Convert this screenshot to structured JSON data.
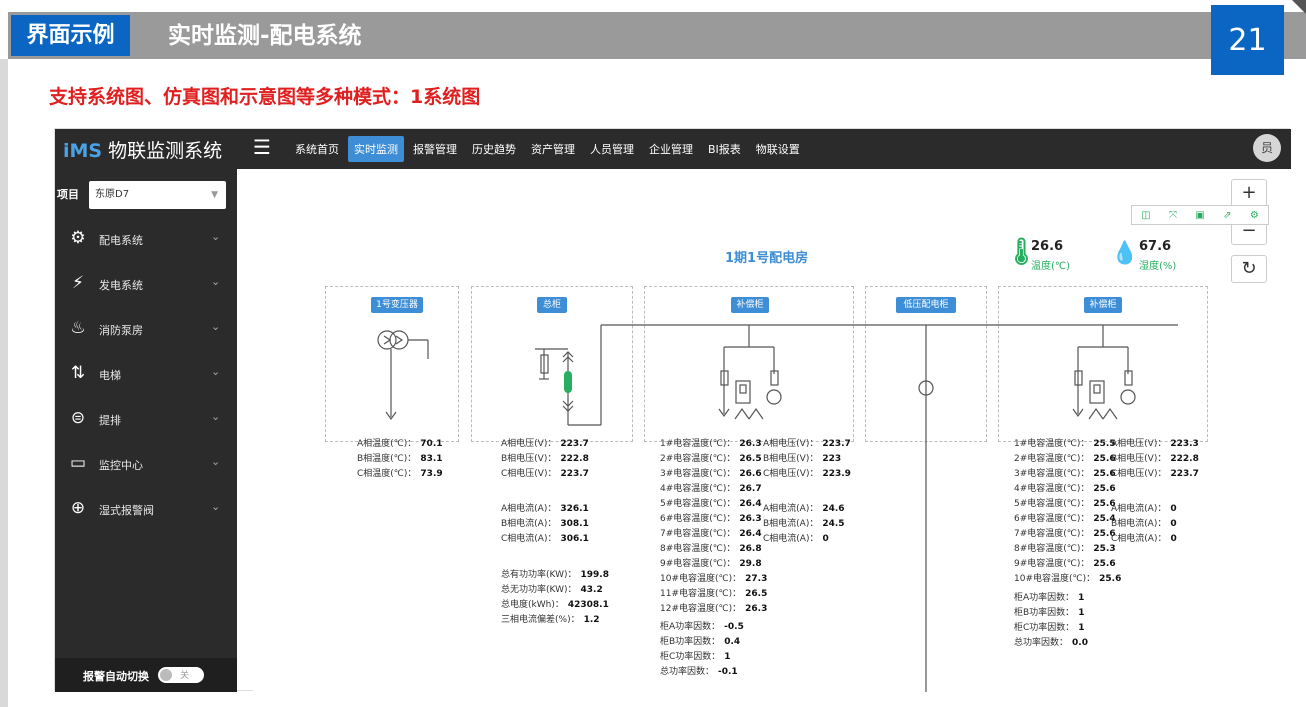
{
  "slide": {
    "badge": "界面示例",
    "title": "实时监测-配电系统",
    "page": "21",
    "subtitle": "支持系统图、仿真图和示意图等多种模式：1系统图"
  },
  "app": {
    "logo_brand": "iMS",
    "logo_text": "物联监测系统",
    "nav": [
      {
        "label": "系统首页"
      },
      {
        "label": "实时监测"
      },
      {
        "label": "报警管理"
      },
      {
        "label": "历史趋势"
      },
      {
        "label": "资产管理"
      },
      {
        "label": "人员管理"
      },
      {
        "label": "企业管理"
      },
      {
        "label": "BI报表"
      },
      {
        "label": "物联设置"
      }
    ],
    "avatar": "员"
  },
  "sidebar": {
    "project_label": "项目",
    "project_value": "东原D7",
    "items": [
      {
        "label": "配电系统",
        "icon": "robot-icon"
      },
      {
        "label": "发电系统",
        "icon": "generator-icon"
      },
      {
        "label": "消防泵房",
        "icon": "hydrant-icon"
      },
      {
        "label": "电梯",
        "icon": "elevator-icon"
      },
      {
        "label": "提排",
        "icon": "pump-icon"
      },
      {
        "label": "监控中心",
        "icon": "monitor-icon"
      },
      {
        "label": "湿式报警阀",
        "icon": "valve-icon"
      }
    ],
    "footer_label": "报警自动切换",
    "toggle_text": "关"
  },
  "diagram": {
    "title": "1期1号配电房",
    "temperature": {
      "value": "26.6",
      "label": "温度(℃)"
    },
    "humidity": {
      "value": "67.6",
      "label": "湿度(%)"
    },
    "tags": [
      "1号变压器",
      "总柜",
      "补偿柜",
      "低压配电柜",
      "补偿柜"
    ],
    "transformer": [
      [
        "A相温度(℃)：",
        "70.1"
      ],
      [
        "B相温度(℃)：",
        "83.1"
      ],
      [
        "C相温度(℃)：",
        "73.9"
      ]
    ],
    "main_v": [
      [
        "A相电压(V)：",
        "223.7"
      ],
      [
        "B相电压(V)：",
        "222.8"
      ],
      [
        "C相电压(V)：",
        "223.7"
      ]
    ],
    "main_i": [
      [
        "A相电流(A)：",
        "326.1"
      ],
      [
        "B相电流(A)：",
        "308.1"
      ],
      [
        "C相电流(A)：",
        "306.1"
      ]
    ],
    "main_p": [
      [
        "总有功功率(KW)：",
        "199.8"
      ],
      [
        "总无功功率(KW)：",
        "43.2"
      ],
      [
        "总电度(kWh)：",
        "42308.1"
      ],
      [
        "三相电流偏差(%)：",
        "1.2"
      ]
    ],
    "comp1_temp": [
      [
        "1#电容温度(℃)：",
        "26.3"
      ],
      [
        "2#电容温度(℃)：",
        "26.5"
      ],
      [
        "3#电容温度(℃)：",
        "26.6"
      ],
      [
        "4#电容温度(℃)：",
        "26.7"
      ],
      [
        "5#电容温度(℃)：",
        "26.4"
      ],
      [
        "6#电容温度(℃)：",
        "26.3"
      ],
      [
        "7#电容温度(℃)：",
        "26.4"
      ],
      [
        "8#电容温度(℃)：",
        "26.8"
      ],
      [
        "9#电容温度(℃)：",
        "29.8"
      ],
      [
        "10#电容温度(℃)：",
        "27.3"
      ],
      [
        "11#电容温度(℃)：",
        "26.5"
      ],
      [
        "12#电容温度(℃)：",
        "26.3"
      ]
    ],
    "comp1_v": [
      [
        "A相电压(V)：",
        "223.7"
      ],
      [
        "B相电压(V)：",
        "223"
      ],
      [
        "C相电压(V)：",
        "223.9"
      ]
    ],
    "comp1_i": [
      [
        "A相电流(A)：",
        "24.6"
      ],
      [
        "B相电流(A)：",
        "24.5"
      ],
      [
        "C相电流(A)：",
        "0"
      ]
    ],
    "comp1_pf": [
      [
        "柜A功率因数：",
        "-0.5"
      ],
      [
        "柜B功率因数：",
        "0.4"
      ],
      [
        "柜C功率因数：",
        "1"
      ],
      [
        "总功率因数：",
        "-0.1"
      ]
    ],
    "comp2_temp": [
      [
        "1#电容温度(℃)：",
        "25.5"
      ],
      [
        "2#电容温度(℃)：",
        "25.6"
      ],
      [
        "3#电容温度(℃)：",
        "25.6"
      ],
      [
        "4#电容温度(℃)：",
        "25.6"
      ],
      [
        "5#电容温度(℃)：",
        "25.6"
      ],
      [
        "6#电容温度(℃)：",
        "25.4"
      ],
      [
        "7#电容温度(℃)：",
        "25.6"
      ],
      [
        "8#电容温度(℃)：",
        "25.3"
      ],
      [
        "9#电容温度(℃)：",
        "25.6"
      ],
      [
        "10#电容温度(℃)：",
        "25.6"
      ]
    ],
    "comp2_v": [
      [
        "A相电压(V)：",
        "223.3"
      ],
      [
        "B相电压(V)：",
        "222.8"
      ],
      [
        "C相电压(V)：",
        "223.7"
      ]
    ],
    "comp2_i": [
      [
        "A相电流(A)：",
        "0"
      ],
      [
        "B相电流(A)：",
        "0"
      ],
      [
        "C相电流(A)：",
        "0"
      ]
    ],
    "comp2_pf": [
      [
        "柜A功率因数：",
        "1"
      ],
      [
        "柜B功率因数：",
        "1"
      ],
      [
        "柜C功率因数：",
        "1"
      ],
      [
        "总功率因数：",
        "0.0"
      ]
    ]
  }
}
